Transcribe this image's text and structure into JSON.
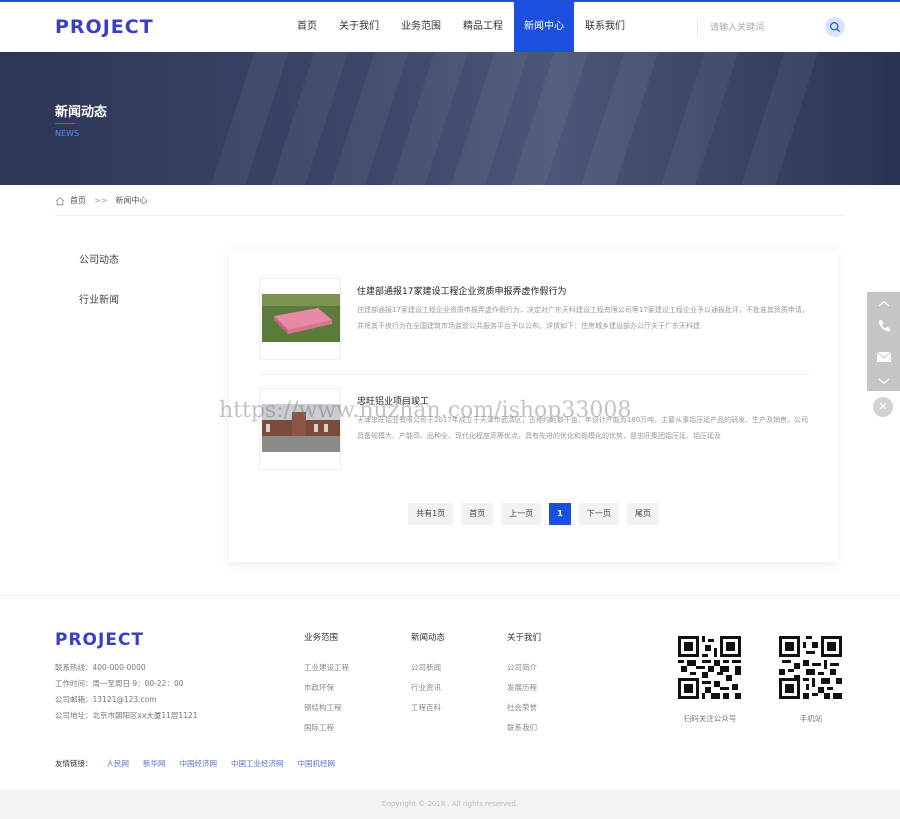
{
  "header": {
    "logo": "PROJECT",
    "nav": [
      "首页",
      "关于我们",
      "业务范围",
      "精品工程",
      "新闻中心",
      "联系我们"
    ],
    "active_nav": "新闻中心",
    "search_placeholder": "请输入关键词"
  },
  "banner": {
    "title": "新闻动态",
    "subtitle": "NEWS"
  },
  "breadcrumb": {
    "home": "首页",
    "separator": ">>",
    "current": "新闻中心"
  },
  "sidebar": {
    "items": [
      "公司动态",
      "行业新闻"
    ]
  },
  "news": [
    {
      "title": "住建部通报17家建设工程企业资质申报弄虚作假行为",
      "desc": "住建部通报17家建设工程企业资质申报弄虚作假行为，决定对广东天科建设工程有限公司等17家建设工程企业予以通报批评，不批准其资质申请，并将其不良行为在全国建筑市场监管公共服务平台予以公布。详情如下：住房城乡建设部办公厅关于广东天科建"
    },
    {
      "title": "忠旺铝业项目竣工",
      "desc": "天津忠旺铝业有限公司于2017年成立于天津市武清区，占地约为数千亩，年设计产能为180万吨，主要从事铝压延产品的研发、生产及销售。公司具备规模大、产能高、品种全、现代化程度高等优点，具有先进的优化和规模化的优势，是忠旺集团铝压延、铝压延及"
    }
  ],
  "pager": {
    "total": "共有1页",
    "first": "首页",
    "prev": "上一页",
    "current": "1",
    "next": "下一页",
    "last": "尾页"
  },
  "watermark": "https://www.huzhan.com/ishop33008",
  "footer": {
    "logo": "PROJECT",
    "info": [
      "联系热线：400-000-0000",
      "工作时间：周一至周日 9：00-22：00",
      "公司邮箱：13121@123.com",
      "公司地址：北京市朝阳区xx大厦11层1121"
    ],
    "columns": [
      {
        "title": "业务范围",
        "links": [
          "工业建设工程",
          "市政环保",
          "钢结构工程",
          "国际工程"
        ]
      },
      {
        "title": "新闻动态",
        "links": [
          "公司新闻",
          "行业资讯",
          "工程百科"
        ]
      },
      {
        "title": "关于我们",
        "links": [
          "公司简介",
          "发展历程",
          "社会荣誉",
          "联系我们"
        ]
      }
    ],
    "qr_labels": [
      "扫码关注公众号",
      "手机站"
    ],
    "friend_label": "友情链接：",
    "friend_links": [
      "人民网",
      "新华网",
      "中国经济网",
      "中国工业经济网",
      "中国机经网"
    ],
    "copyright": "Copyright © 2018 . All rights reserved."
  },
  "colors": {
    "accent": "#1a4fe0",
    "logo": "#3a3fc4"
  }
}
